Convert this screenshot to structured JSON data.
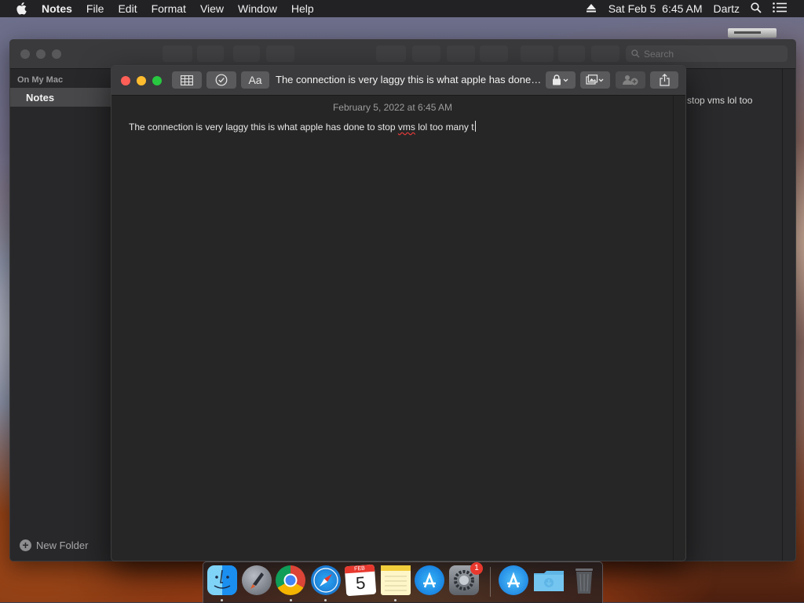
{
  "menubar": {
    "app_name": "Notes",
    "items": [
      "File",
      "Edit",
      "Format",
      "View",
      "Window",
      "Help"
    ],
    "date_time": "Sat Feb 5  6:45 AM",
    "user": "Dartz"
  },
  "main_window": {
    "search_placeholder": "Search",
    "sidebar": {
      "section_header": "On My Mac",
      "folder": "Notes",
      "new_folder": "New Folder"
    },
    "note_list_snippet": "stop vms lol too"
  },
  "note_window": {
    "title": "The connection is very laggy this is what apple has done to stop vms lol too many t",
    "date": "February 5, 2022 at 6:45 AM",
    "body_before": "The connection is very laggy this is what apple has done to stop ",
    "body_misspelled": "vms",
    "body_after": " lol too many t"
  },
  "dock": {
    "apps": [
      "Finder",
      "Launchpad",
      "Google Chrome",
      "Safari",
      "Calendar",
      "Notes",
      "App Store",
      "System Preferences",
      "App Store Installer",
      "Downloads",
      "Trash"
    ],
    "calendar_month": "FEB",
    "calendar_day": "5",
    "system_prefs_badge": "1"
  },
  "colors": {
    "menubar_bg": "#222225",
    "window_bg": "#262626",
    "close": "#ff5f57",
    "minimize": "#febc2e",
    "zoom": "#28c840"
  }
}
